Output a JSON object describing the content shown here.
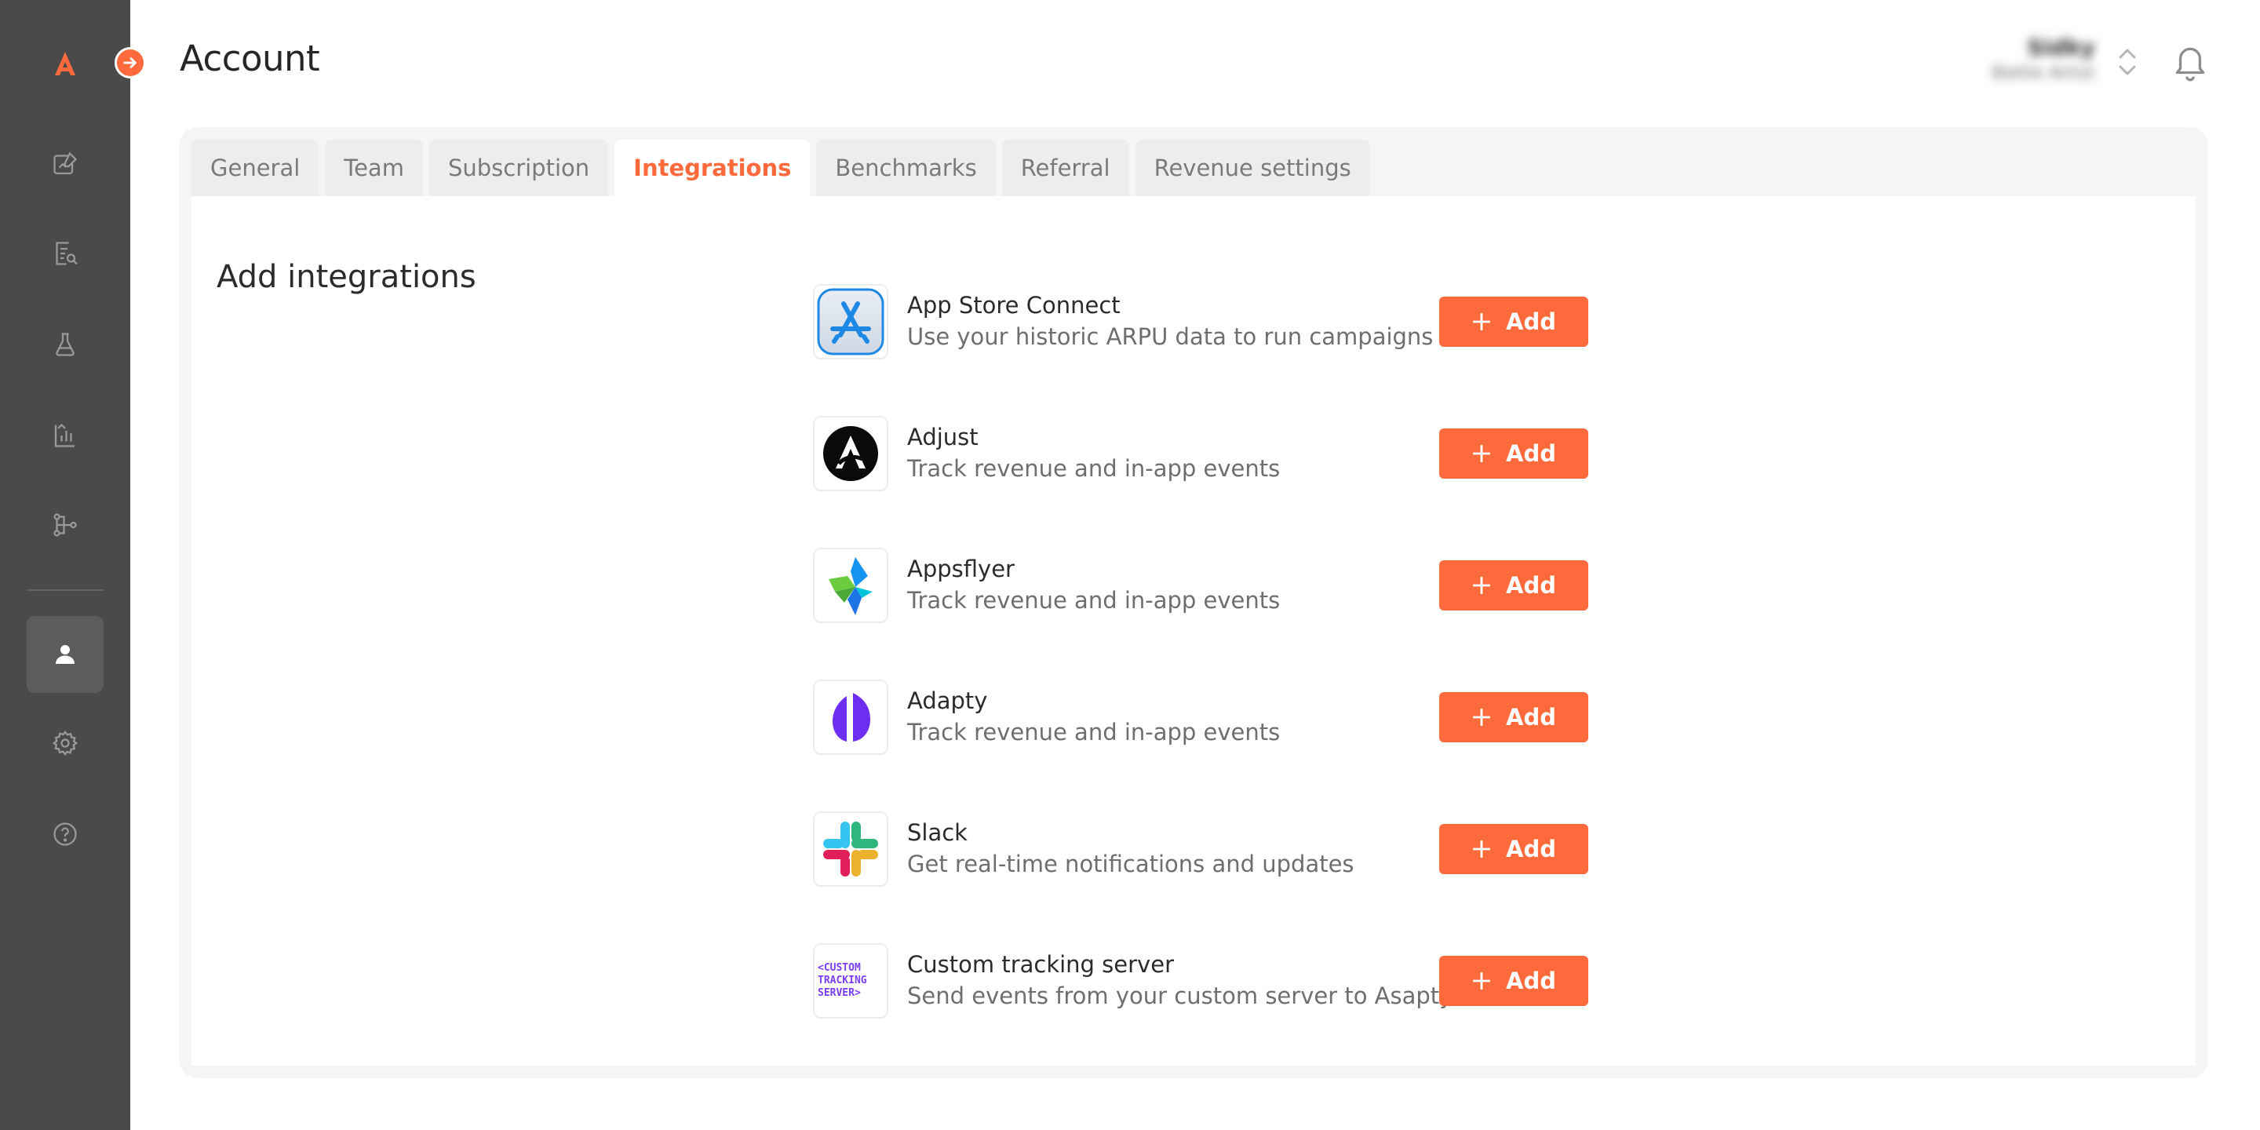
{
  "app": {
    "brand_color": "#ff6a3c",
    "sidebar_color": "#4a4a4a"
  },
  "sidebar": {
    "items": [
      {
        "icon": "dashboard-edit-icon"
      },
      {
        "icon": "report-search-icon"
      },
      {
        "icon": "flask-icon"
      },
      {
        "icon": "analytics-icon"
      },
      {
        "icon": "flow-icon"
      },
      {
        "icon": "user-icon",
        "active": true
      },
      {
        "icon": "gear-icon"
      },
      {
        "icon": "help-icon"
      }
    ]
  },
  "header": {
    "title": "Account",
    "user_name": "Sidky",
    "user_sub": "Bottle Artist"
  },
  "tabs": [
    {
      "label": "General"
    },
    {
      "label": "Team"
    },
    {
      "label": "Subscription"
    },
    {
      "label": "Integrations",
      "active": true
    },
    {
      "label": "Benchmarks"
    },
    {
      "label": "Referral"
    },
    {
      "label": "Revenue settings"
    }
  ],
  "section": {
    "title": "Add integrations"
  },
  "integrations": [
    {
      "name": "App Store Connect",
      "description": "Use your historic ARPU data to run campaigns",
      "button": "Add",
      "icon": "app-store-icon"
    },
    {
      "name": "Adjust",
      "description": "Track revenue and in-app events",
      "button": "Add",
      "icon": "adjust-icon"
    },
    {
      "name": "Appsflyer",
      "description": "Track revenue and in-app events",
      "button": "Add",
      "icon": "appsflyer-icon"
    },
    {
      "name": "Adapty",
      "description": "Track revenue and in-app events",
      "button": "Add",
      "icon": "adapty-icon"
    },
    {
      "name": "Slack",
      "description": "Get real-time notifications and updates",
      "button": "Add",
      "icon": "slack-icon"
    },
    {
      "name": "Custom tracking server",
      "description": "Send events from your custom server to Asapty",
      "button": "Add",
      "icon": "custom-server-icon"
    }
  ],
  "custom_logo_text": [
    "<CUSTOM",
    "TRACKING",
    "SERVER>"
  ]
}
